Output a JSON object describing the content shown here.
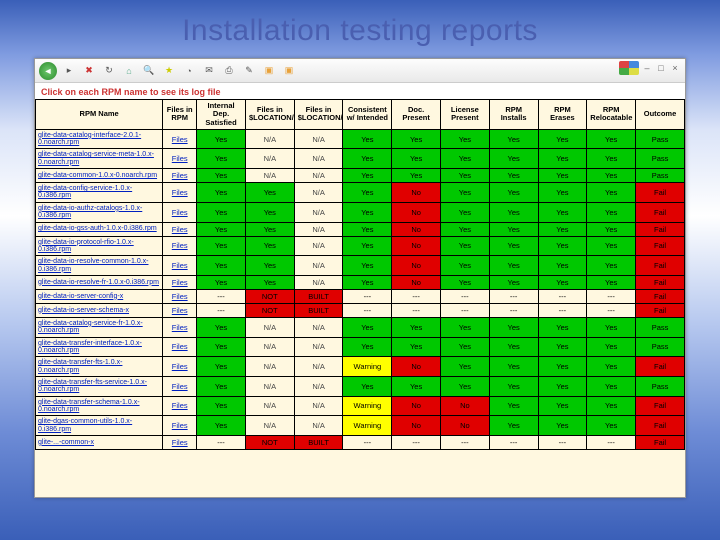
{
  "page_title": "Installation testing reports",
  "hint": "Click on each RPM name to see its log file",
  "columns": [
    "RPM Name",
    "Files in RPM",
    "Internal Dep. Satisfied",
    "Files in $LOCATION/lib",
    "Files in $LOCATION/bin",
    "Consistent w/ Intended",
    "Doc. Present",
    "License Present",
    "RPM Installs",
    "RPM Erases",
    "RPM Relocatable",
    "Outcome"
  ],
  "files_label": "Files",
  "cell_text": {
    "yes": "Yes",
    "no": "No",
    "na": "N/A",
    "warn": "Warning",
    "not": "NOT",
    "built": "BUILT",
    "pass": "Pass",
    "fail": "Fail",
    "dash": "---"
  },
  "rows": [
    {
      "name": "glite-data-catalog-interface-2.0.1-0.noarch.rpm",
      "c": [
        "g-yes",
        "na",
        "na",
        "g-yes",
        "g-yes",
        "g-yes",
        "g-yes",
        "g-yes",
        "g-yes",
        "g-pass"
      ]
    },
    {
      "name": "glite-data-catalog-service-meta-1.0.x-0.noarch.rpm",
      "c": [
        "g-yes",
        "na",
        "na",
        "g-yes",
        "g-yes",
        "g-yes",
        "g-yes",
        "g-yes",
        "g-yes",
        "g-pass"
      ]
    },
    {
      "name": "glite-data-common-1.0.x-0.noarch.rpm",
      "c": [
        "g-yes",
        "na",
        "na",
        "g-yes",
        "g-yes",
        "g-yes",
        "g-yes",
        "g-yes",
        "g-yes",
        "g-pass"
      ]
    },
    {
      "name": "glite-data-config-service-1.0.x-0.i386.rpm",
      "c": [
        "g-yes",
        "g-yes",
        "na",
        "g-yes",
        "r-no",
        "g-yes",
        "g-yes",
        "g-yes",
        "g-yes",
        "r-fail"
      ]
    },
    {
      "name": "glite-data-io-authz-catalogs-1.0.x-0.i386.rpm",
      "c": [
        "g-yes",
        "g-yes",
        "na",
        "g-yes",
        "r-no",
        "g-yes",
        "g-yes",
        "g-yes",
        "g-yes",
        "r-fail"
      ]
    },
    {
      "name": "glite-data-io-gss-auth-1.0.x-0.i386.rpm",
      "c": [
        "g-yes",
        "g-yes",
        "na",
        "g-yes",
        "r-no",
        "g-yes",
        "g-yes",
        "g-yes",
        "g-yes",
        "r-fail"
      ]
    },
    {
      "name": "glite-data-io-protocol-rfio-1.0.x-0.i386.rpm",
      "c": [
        "g-yes",
        "g-yes",
        "na",
        "g-yes",
        "r-no",
        "g-yes",
        "g-yes",
        "g-yes",
        "g-yes",
        "r-fail"
      ]
    },
    {
      "name": "glite-data-io-resolve-common-1.0.x-0.i386.rpm",
      "c": [
        "g-yes",
        "g-yes",
        "na",
        "g-yes",
        "r-no",
        "g-yes",
        "g-yes",
        "g-yes",
        "g-yes",
        "r-fail"
      ]
    },
    {
      "name": "glite-data-io-resolve-fr-1.0.x-0.i386.rpm",
      "c": [
        "g-yes",
        "g-yes",
        "na",
        "g-yes",
        "r-no",
        "g-yes",
        "g-yes",
        "g-yes",
        "g-yes",
        "r-fail"
      ]
    },
    {
      "name": "glite-data-io-server-config-x",
      "c": [
        "dash",
        "not",
        "built",
        "dash",
        "dash",
        "dash",
        "dash",
        "dash",
        "dash",
        "r-fail"
      ]
    },
    {
      "name": "glite-data-io-server-schema-x",
      "c": [
        "dash",
        "not",
        "built",
        "dash",
        "dash",
        "dash",
        "dash",
        "dash",
        "dash",
        "r-fail"
      ]
    },
    {
      "name": "glite-data-catalog-service-fr-1.0.x-0.noarch.rpm",
      "c": [
        "g-yes",
        "na",
        "na",
        "g-yes",
        "g-yes",
        "g-yes",
        "g-yes",
        "g-yes",
        "g-yes",
        "g-pass"
      ]
    },
    {
      "name": "glite-data-transfer-interface-1.0.x-0.noarch.rpm",
      "c": [
        "g-yes",
        "na",
        "na",
        "g-yes",
        "g-yes",
        "g-yes",
        "g-yes",
        "g-yes",
        "g-yes",
        "g-pass"
      ]
    },
    {
      "name": "glite-data-transfer-fts-1.0.x-0.noarch.rpm",
      "c": [
        "g-yes",
        "na",
        "na",
        "y-warn",
        "r-no",
        "g-yes",
        "g-yes",
        "g-yes",
        "g-yes",
        "r-fail"
      ]
    },
    {
      "name": "glite-data-transfer-fts-service-1.0.x-0.noarch.rpm",
      "c": [
        "g-yes",
        "na",
        "na",
        "g-yes",
        "g-yes",
        "g-yes",
        "g-yes",
        "g-yes",
        "g-yes",
        "g-pass"
      ]
    },
    {
      "name": "glite-data-transfer-schema-1.0.x-0.noarch.rpm",
      "c": [
        "g-yes",
        "na",
        "na",
        "y-warn",
        "r-no",
        "r-no",
        "g-yes",
        "g-yes",
        "g-yes",
        "r-fail"
      ]
    },
    {
      "name": "glite-dgas-common-utils-1.0.x-0.i386.rpm",
      "c": [
        "g-yes",
        "na",
        "na",
        "y-warn",
        "r-no",
        "r-no",
        "g-yes",
        "g-yes",
        "g-yes",
        "r-fail"
      ]
    },
    {
      "name": "glite-...-common-x",
      "c": [
        "dash",
        "not",
        "built",
        "dash",
        "dash",
        "dash",
        "dash",
        "dash",
        "dash",
        "r-fail"
      ]
    }
  ]
}
